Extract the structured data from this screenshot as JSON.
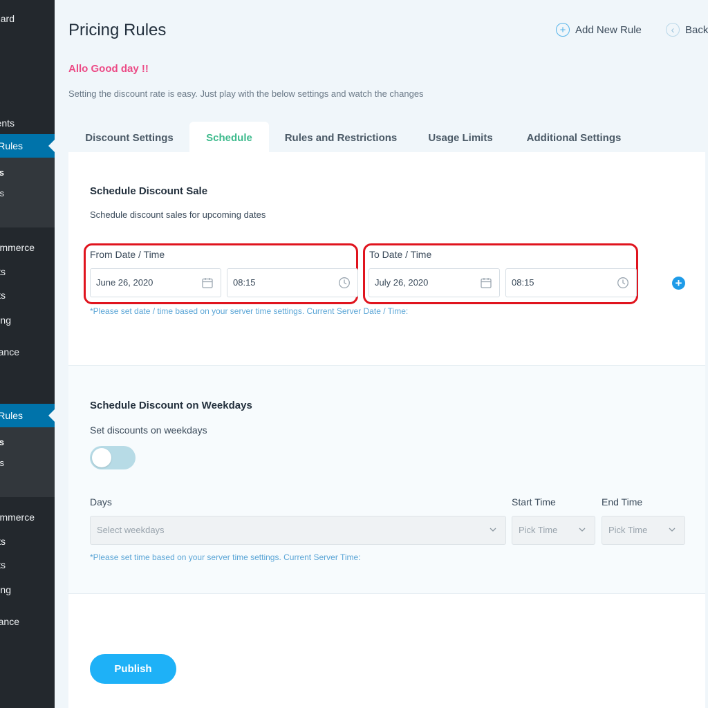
{
  "sidebar": {
    "items": [
      {
        "label": "ard"
      },
      {
        "label": "ents"
      },
      {
        "label": "Rules"
      },
      {
        "label": "s"
      },
      {
        "label": "s"
      },
      {
        "label": "mmerce"
      },
      {
        "label": "ts"
      },
      {
        "label": "ts"
      },
      {
        "label": "ing"
      },
      {
        "label": "ance"
      },
      {
        "label": "Rules"
      },
      {
        "label": "s"
      },
      {
        "label": "s"
      },
      {
        "label": "mmerce"
      },
      {
        "label": "ts"
      },
      {
        "label": "ts"
      },
      {
        "label": "ing"
      },
      {
        "label": "ance"
      }
    ]
  },
  "header": {
    "title": "Pricing Rules",
    "add_new_rule": "Add New Rule",
    "back": "Back",
    "greeting": "Allo Good day !!",
    "subtext": "Setting the discount rate is easy. Just play with the below settings and watch the changes"
  },
  "tabs": [
    {
      "label": "Discount Settings"
    },
    {
      "label": "Schedule"
    },
    {
      "label": "Rules and Restrictions"
    },
    {
      "label": "Usage Limits"
    },
    {
      "label": "Additional Settings"
    }
  ],
  "schedule_sale": {
    "title": "Schedule Discount Sale",
    "description": "Schedule discount sales for upcoming dates",
    "from_label": "From Date / Time",
    "from_date": "June 26, 2020",
    "from_time": "08:15",
    "to_label": "To Date / Time",
    "to_date": "July 26, 2020",
    "to_time": "08:15",
    "hint": "*Please set date / time based on your server time settings. Current Server Date / Time:"
  },
  "weekdays": {
    "title": "Schedule Discount on Weekdays",
    "toggle_label": "Set discounts on weekdays",
    "toggle_on": false,
    "days_label": "Days",
    "days_placeholder": "Select weekdays",
    "start_label": "Start Time",
    "start_placeholder": "Pick Time",
    "end_label": "End Time",
    "end_placeholder": "Pick Time",
    "hint": "*Please set time based on your server time settings. Current Server Time:"
  },
  "publish_label": "Publish",
  "colors": {
    "accent": "#1eb1f7",
    "tab_active": "#3dba8c",
    "greeting": "#ec4b86",
    "highlight": "#e0141e",
    "sidebar_active": "#0073aa"
  }
}
